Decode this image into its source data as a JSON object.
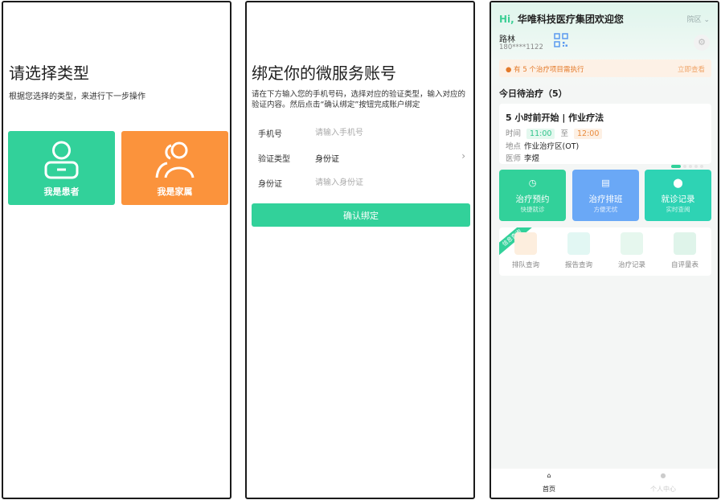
{
  "screen1": {
    "title": "请选择类型",
    "subtitle": "根据您选择的类型，来进行下一步操作",
    "patient_label": "我是患者",
    "family_label": "我是家属",
    "colors": {
      "patient": "#32d19a",
      "family": "#fb933c"
    }
  },
  "screen2": {
    "title": "绑定你的微服务账号",
    "subtitle": "请在下方输入您的手机号码，选择对应的验证类型，输入对应的验证内容。然后点击“确认绑定”按钮完成账户绑定",
    "phone": {
      "label": "手机号",
      "placeholder": "请输入手机号"
    },
    "verify_type": {
      "label": "验证类型",
      "value": "身份证"
    },
    "id_card": {
      "label": "身份证",
      "placeholder": "请输入身份证"
    },
    "confirm_label": "确认绑定"
  },
  "screen3": {
    "greeting_hi": "Hi,",
    "greeting_text": "华唯科技医疗集团欢迎您",
    "area_label": "院区",
    "user_name": "路林",
    "user_phone": "180****1122",
    "notice_text": "有 5 个治疗项目需执行",
    "notice_link": "立即查看",
    "today_title": "今日待治疗（5）",
    "treatment": {
      "title": "5 小时前开始 | 作业疗法",
      "time_label": "时间",
      "start": "11:00",
      "to": "至",
      "end": "12:00",
      "place_label": "地点",
      "place": "作业治疗区(OT)",
      "doctor_label": "医师",
      "doctor": "李煜"
    },
    "tiles": [
      {
        "title": "治疗预约",
        "sub": "快捷就诊"
      },
      {
        "title": "治疗排班",
        "sub": "方便无忧"
      },
      {
        "title": "就诊记录",
        "sub": "实时查阅"
      }
    ],
    "ribbon": "信息查询",
    "services": [
      "排队查询",
      "报告查询",
      "治疗记录",
      "自评量表"
    ],
    "tab_home": "首页",
    "tab_profile": "个人中心"
  }
}
